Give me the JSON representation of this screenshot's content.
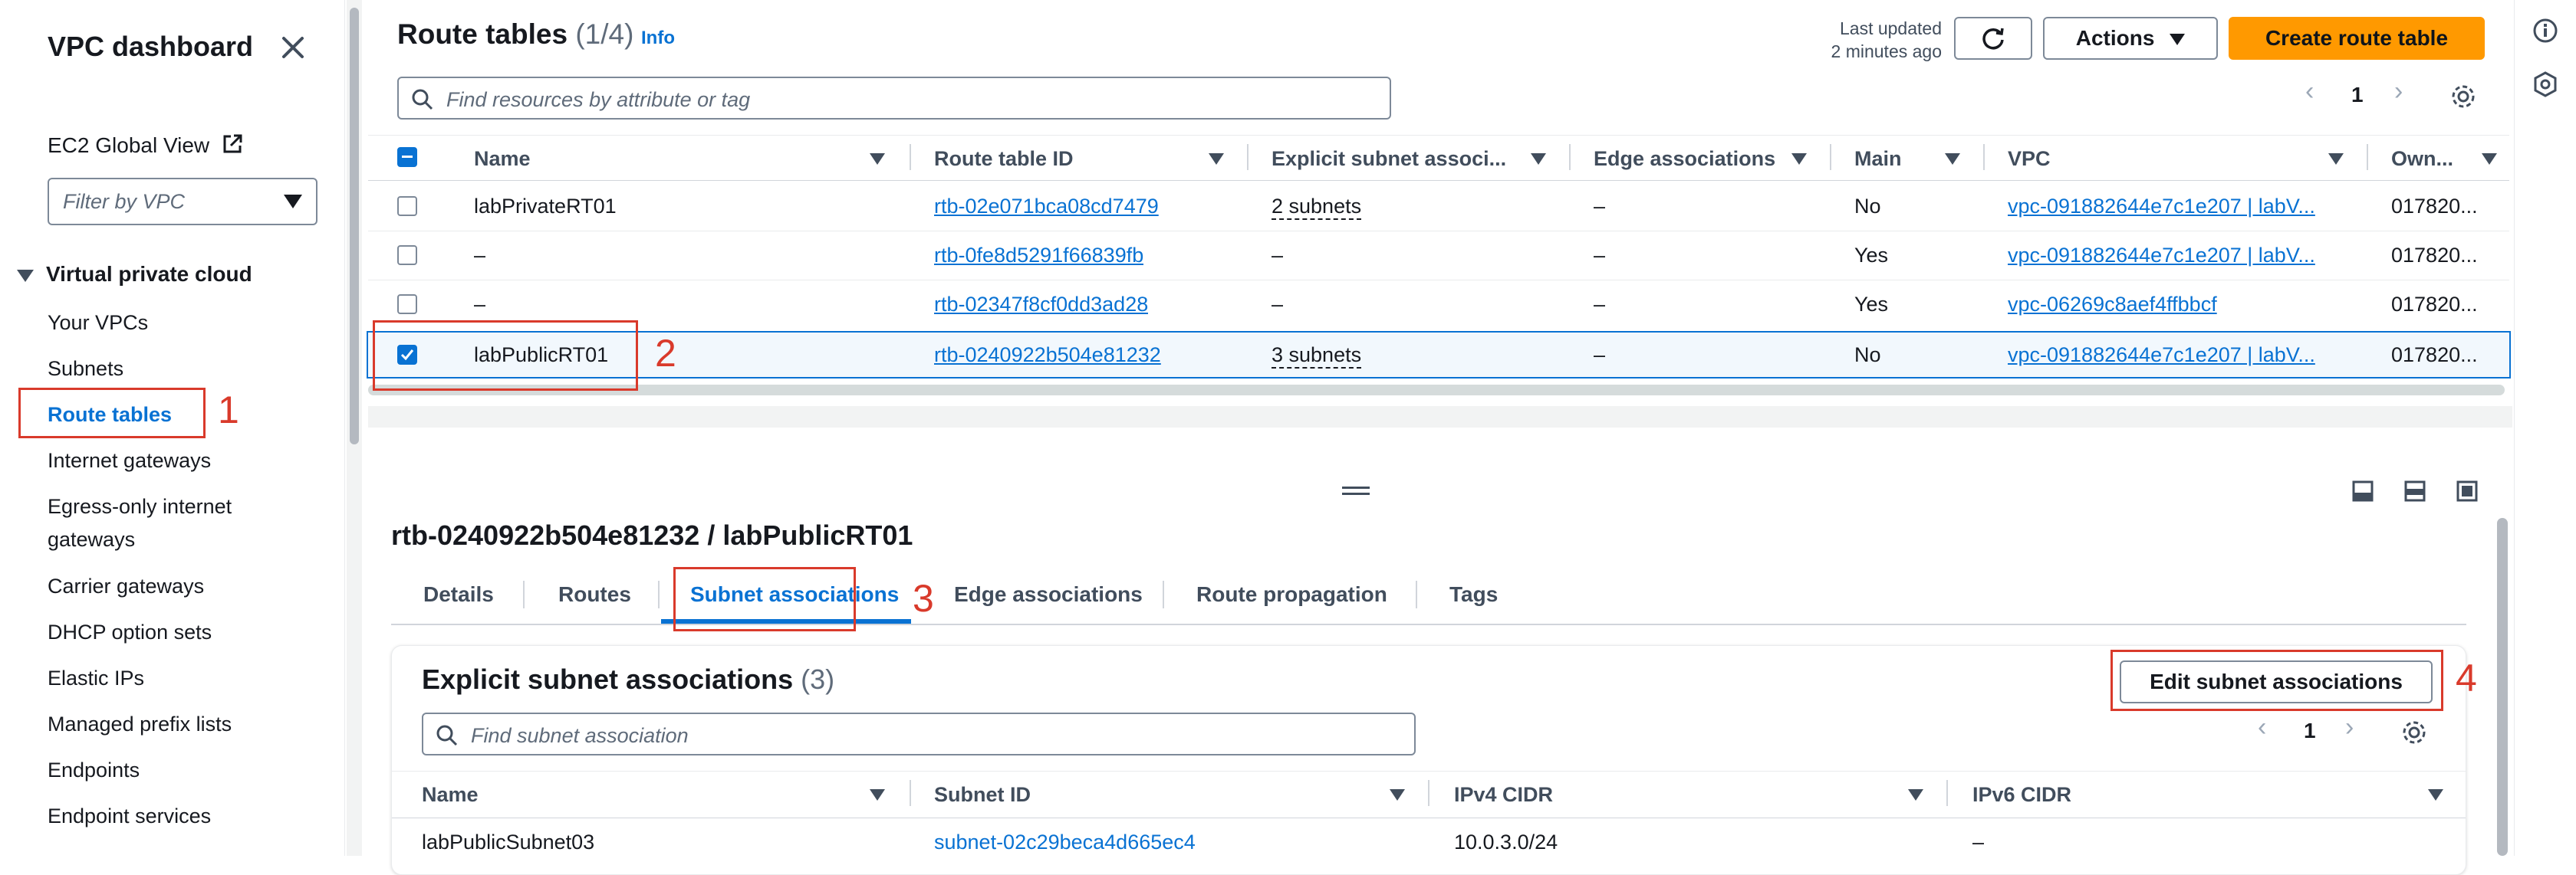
{
  "sidebar": {
    "title": "VPC dashboard",
    "ec2_global_view": "EC2 Global View",
    "filter_placeholder": "Filter by VPC",
    "section": "Virtual private cloud",
    "items": [
      "Your VPCs",
      "Subnets",
      "Route tables",
      "Internet gateways",
      "Egress-only internet",
      "gateways",
      "Carrier gateways",
      "DHCP option sets",
      "Elastic IPs",
      "Managed prefix lists",
      "Endpoints",
      "Endpoint services"
    ]
  },
  "header": {
    "title": "Route tables",
    "count": "(1/4)",
    "info": "Info",
    "last_updated_1": "Last updated",
    "last_updated_2": "2 minutes ago",
    "actions": "Actions",
    "create": "Create route table",
    "search_placeholder": "Find resources by attribute or tag",
    "page": "1"
  },
  "table": {
    "columns": [
      "Name",
      "Route table ID",
      "Explicit subnet associ...",
      "Edge associations",
      "Main",
      "VPC",
      "Own..."
    ],
    "rows": [
      {
        "name": "labPrivateRT01",
        "id": "rtb-02e071bca08cd7479",
        "explicit": "2 subnets",
        "edge": "–",
        "main": "No",
        "vpc": "vpc-091882644e7c1e207 | labV...",
        "owner": "017820..."
      },
      {
        "name": "–",
        "id": "rtb-0fe8d5291f66839fb",
        "explicit": "–",
        "edge": "–",
        "main": "Yes",
        "vpc": "vpc-091882644e7c1e207 | labV...",
        "owner": "017820..."
      },
      {
        "name": "–",
        "id": "rtb-02347f8cf0dd3ad28",
        "explicit": "–",
        "edge": "–",
        "main": "Yes",
        "vpc": "vpc-06269c8aef4ffbbcf",
        "owner": "017820..."
      },
      {
        "name": "labPublicRT01",
        "id": "rtb-0240922b504e81232",
        "explicit": "3 subnets",
        "edge": "–",
        "main": "No",
        "vpc": "vpc-091882644e7c1e207 | labV...",
        "owner": "017820..."
      }
    ]
  },
  "callouts": [
    "1",
    "2",
    "3",
    "4"
  ],
  "detail": {
    "title": "rtb-0240922b504e81232 / labPublicRT01",
    "tabs": [
      "Details",
      "Routes",
      "Subnet associations",
      "Edge associations",
      "Route propagation",
      "Tags"
    ],
    "section_title": "Explicit subnet associations",
    "section_count": "(3)",
    "edit_button": "Edit subnet associations",
    "search_placeholder": "Find subnet association",
    "page": "1",
    "columns": [
      "Name",
      "Subnet ID",
      "IPv4 CIDR",
      "IPv6 CIDR"
    ],
    "rows": [
      {
        "name": "labPublicSubnet03",
        "subnet": "subnet-02c29beca4d665ec4",
        "ipv4": "10.0.3.0/24",
        "ipv6": "–"
      }
    ]
  },
  "colors": {
    "link": "#0972d3",
    "primary": "#ff9900",
    "callout": "#d93a2b"
  }
}
